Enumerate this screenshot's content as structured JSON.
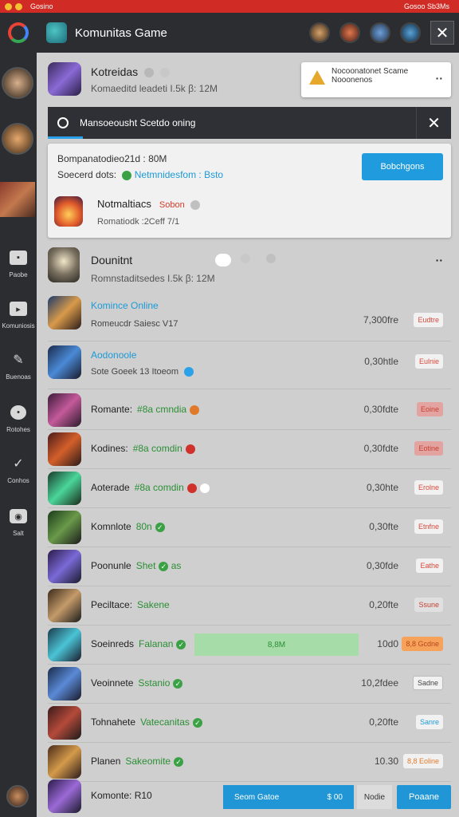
{
  "status_bar": {
    "left_label": "Gosino",
    "right_label": "Gosoo Sb3Ms"
  },
  "topbar": {
    "title": "Komunitas Game",
    "close_symbol": "✕"
  },
  "sidebar": {
    "items": [
      {
        "label": "Paobe",
        "icon": "gamepad-icon"
      },
      {
        "label": "Komuniosis",
        "icon": "chat-icon"
      },
      {
        "label": "Buenoas",
        "icon": "pencil-icon"
      },
      {
        "label": "Rotohes",
        "icon": "pin-icon"
      },
      {
        "label": "Conhos",
        "icon": "check-icon"
      },
      {
        "label": "Salt",
        "icon": "settings-icon"
      }
    ]
  },
  "header": {
    "title": "Kotreidas",
    "meta": "Komaeditd leadeti I.5k  β:  12M"
  },
  "notification": {
    "line1": "Nocoonatonet Scame",
    "line2": "Nooonenos"
  },
  "banner": {
    "text": "Mansoeousht Scetdo oning",
    "close_symbol": "✕"
  },
  "card": {
    "line1": "Bompanatodieo21d : 80M",
    "line2_prefix": "Soecerd dots:",
    "line2_link": "Netmnidesfom : Bsto",
    "button_label": "Bobchgons",
    "sub_title": "Notmaltiacs",
    "sub_status": "Sobon",
    "sub_meta": "Romatiodk  :2Ceff 7/1"
  },
  "group": {
    "title": "Dounitnt",
    "meta": "Romnstaditsedes I.5k  β:  12M"
  },
  "rows": [
    {
      "name": "Komince Online",
      "sub": "",
      "meta": "Romeucdr  Saiesc  V17",
      "value": "7,300fre",
      "pill": "Eudtre"
    },
    {
      "name": "Aodonoole",
      "sub": "",
      "meta": "Sote Goeek  13  Itoeom",
      "value": "0,30htle",
      "pill": "Eulnie"
    },
    {
      "name": "Romante:",
      "sub": "#8a cmndia",
      "meta": "",
      "value": "0,30fdte",
      "pill": "Eoine"
    },
    {
      "name": "Kodines:",
      "sub": "#8a comdin",
      "meta": "",
      "value": "0,30fdte",
      "pill": "Eotine"
    },
    {
      "name": "Aoterade",
      "sub": "#8a comdin",
      "meta": "",
      "value": "0,30hte",
      "pill": "Erolne"
    },
    {
      "name": "Komnlote",
      "sub": "80n",
      "meta": "",
      "value": "0,30fte",
      "pill": "Etnfne"
    },
    {
      "name": "Poonunle",
      "sub": "Shet",
      "meta": "as",
      "value": "0,30fde",
      "pill": "Eathe"
    },
    {
      "name": "Peciltace:",
      "sub": "Sakene",
      "meta": "",
      "value": "0,20fte",
      "pill": "Ssune"
    },
    {
      "name": "Soeinreds",
      "sub": "Falanan",
      "meta": "8,8M",
      "value": "10d0",
      "pill": "8,8 Gcdne"
    },
    {
      "name": "Veoinnete",
      "sub": "Sstanio",
      "meta": "",
      "value": "10,2fdee",
      "pill": "Sadne"
    },
    {
      "name": "Tohnahete",
      "sub": "Vatecanitas",
      "meta": "",
      "value": "0,20fte",
      "pill": "Sanre"
    },
    {
      "name": "Planen",
      "sub": "Sakeomite",
      "meta": "",
      "value": "10.30",
      "pill": "8,8 Eoline"
    },
    {
      "name": "Komonte:",
      "sub": "R10",
      "meta": "",
      "value": "",
      "pill": ""
    }
  ],
  "bottom": {
    "field_left": "Seom Gatoe",
    "field_right": "$ 00",
    "grey_label": "Nodie",
    "primary_label": "Poaane"
  }
}
